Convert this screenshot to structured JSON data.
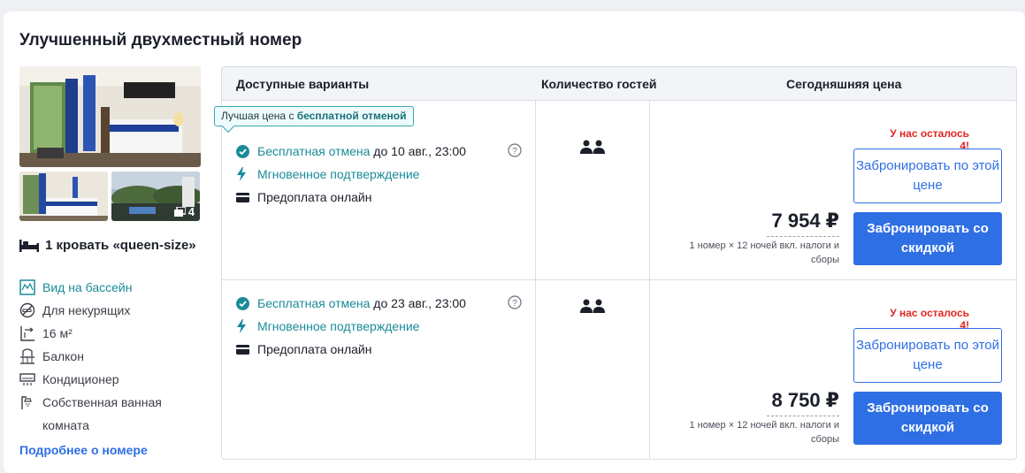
{
  "room": {
    "title": "Улучшенный двухместный номер",
    "photo_count": "4",
    "bed": "1 кровать «queen-size»",
    "amenities": [
      {
        "label": "Вид на бассейн",
        "icon": "pool-view-icon",
        "highlight": true
      },
      {
        "label": "Для некурящих",
        "icon": "no-smoking-icon",
        "highlight": false
      },
      {
        "label": "16 м²",
        "icon": "room-size-icon",
        "highlight": false
      },
      {
        "label": "Балкон",
        "icon": "balcony-icon",
        "highlight": false
      },
      {
        "label": "Кондиционер",
        "icon": "air-conditioner-icon",
        "highlight": false
      },
      {
        "label": "Собственная ванная комната",
        "icon": "shower-icon",
        "highlight": false
      }
    ],
    "more_link": "Подробнее о номере"
  },
  "table": {
    "col_options": "Доступные варианты",
    "col_guests": "Количество гостей",
    "col_price": "Сегодняшняя цена",
    "badge": {
      "prefix": "Лучшая цена с ",
      "bold": "бесплатной отменой"
    },
    "rows": [
      {
        "free_cancel": "Бесплатная отмена",
        "cancel_until": " до 10 авг., 23:00",
        "instant": "Мгновенное подтверждение",
        "prepay": "Предоплата онлайн",
        "rooms_left": "У нас осталось 4!",
        "price": "7 954 ₽",
        "price_note": "1 номер × 12 ночей вкл. налоги и сборы",
        "book_label": "Забронировать по этой цене",
        "book_discount_label": "Забронировать со скидкой"
      },
      {
        "free_cancel": "Бесплатная отмена",
        "cancel_until": " до 23 авг., 23:00",
        "instant": "Мгновенное подтверждение",
        "prepay": "Предоплата онлайн",
        "rooms_left": "У нас осталось 4!",
        "price": "8 750 ₽",
        "price_note": "1 номер × 12 ночей вкл. налоги и сборы",
        "book_label": "Забронировать по этой цене",
        "book_discount_label": "Забронировать со скидкой"
      }
    ]
  },
  "colors": {
    "accent": "#2f6fe4",
    "teal": "#1a8b9a",
    "alert": "#e0261f"
  }
}
